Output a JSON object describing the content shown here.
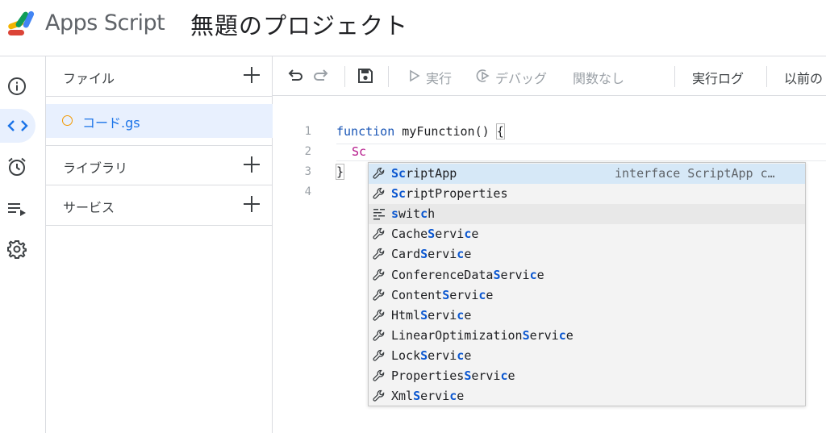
{
  "header": {
    "app_name": "Apps Script",
    "project_title": "無題のプロジェクト"
  },
  "rail": {
    "items": [
      {
        "icon": "info-icon"
      },
      {
        "icon": "code-icon",
        "active": true
      },
      {
        "icon": "alarm-icon"
      },
      {
        "icon": "executions-icon"
      },
      {
        "icon": "gear-icon"
      }
    ]
  },
  "panel": {
    "files_label": "ファイル",
    "file_name": "コード.gs",
    "libraries_label": "ライブラリ",
    "services_label": "サービス"
  },
  "toolbar": {
    "run_label": "実行",
    "debug_label": "デバッグ",
    "function_select": "関数なし",
    "log_label": "実行ログ",
    "history_label": "以前の"
  },
  "editor": {
    "line_numbers": [
      "1",
      "2",
      "3",
      "4"
    ],
    "line1_keyword": "function",
    "line1_name": " myFunction() ",
    "line1_brace": "{",
    "line2_text": "Sc",
    "line3_text": "}"
  },
  "suggestions": [
    {
      "pre": "",
      "m1": "Sc",
      "mid": "riptApp",
      "m2": "",
      "post": "",
      "icon": "wrench-icon",
      "detail": "interface ScriptApp c…",
      "state": "selected"
    },
    {
      "pre": "",
      "m1": "Sc",
      "mid": "riptProperties",
      "m2": "",
      "post": "",
      "icon": "wrench-icon",
      "detail": "",
      "state": ""
    },
    {
      "pre": "",
      "m1": "s",
      "mid": "wit",
      "m2": "c",
      "post": "h",
      "icon": "snippet-icon",
      "detail": "",
      "state": "hover"
    },
    {
      "pre": "Cache",
      "m1": "S",
      "mid": "ervi",
      "m2": "c",
      "post": "e",
      "icon": "wrench-icon",
      "detail": "",
      "state": ""
    },
    {
      "pre": "Card",
      "m1": "S",
      "mid": "ervi",
      "m2": "c",
      "post": "e",
      "icon": "wrench-icon",
      "detail": "",
      "state": ""
    },
    {
      "pre": "ConferenceData",
      "m1": "S",
      "mid": "ervi",
      "m2": "c",
      "post": "e",
      "icon": "wrench-icon",
      "detail": "",
      "state": ""
    },
    {
      "pre": "Content",
      "m1": "S",
      "mid": "ervi",
      "m2": "c",
      "post": "e",
      "icon": "wrench-icon",
      "detail": "",
      "state": ""
    },
    {
      "pre": "Html",
      "m1": "S",
      "mid": "ervi",
      "m2": "c",
      "post": "e",
      "icon": "wrench-icon",
      "detail": "",
      "state": ""
    },
    {
      "pre": "LinearOptimization",
      "m1": "S",
      "mid": "ervi",
      "m2": "c",
      "post": "e",
      "icon": "wrench-icon",
      "detail": "",
      "state": ""
    },
    {
      "pre": "Lock",
      "m1": "S",
      "mid": "ervi",
      "m2": "c",
      "post": "e",
      "icon": "wrench-icon",
      "detail": "",
      "state": ""
    },
    {
      "pre": "Properties",
      "m1": "S",
      "mid": "ervi",
      "m2": "c",
      "post": "e",
      "icon": "wrench-icon",
      "detail": "",
      "state": ""
    },
    {
      "pre": "Xml",
      "m1": "S",
      "mid": "ervi",
      "m2": "c",
      "post": "e",
      "icon": "wrench-icon",
      "detail": "",
      "state": ""
    }
  ]
}
